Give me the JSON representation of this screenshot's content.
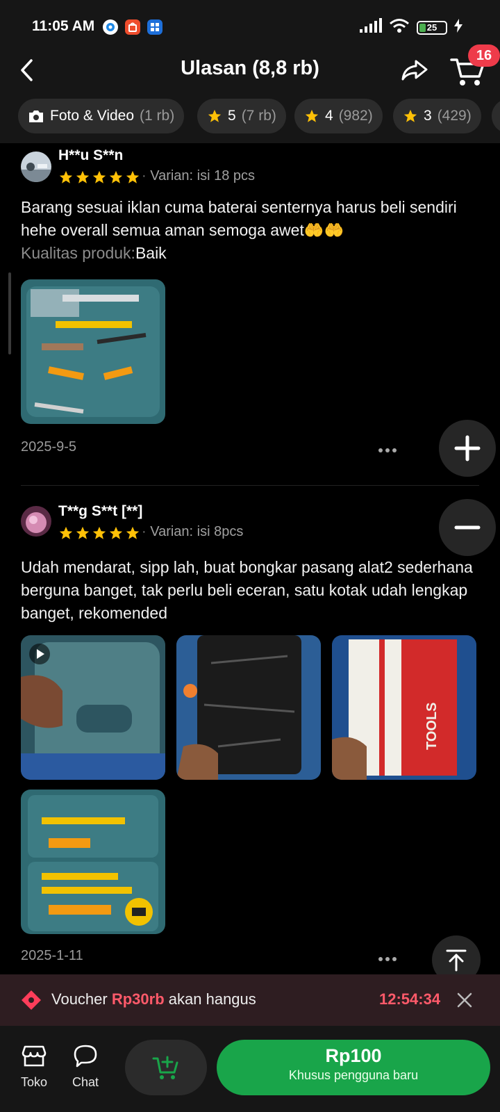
{
  "status_bar": {
    "time": "11:05 AM",
    "battery": "25",
    "battery_level": 0.25
  },
  "header": {
    "title": "Ulasan (8,8 rb)",
    "cart_badge": "16"
  },
  "filters": [
    {
      "label": "Foto & Video",
      "count": "(1 rb)"
    },
    {
      "label": "5",
      "count": "(7 rb)"
    },
    {
      "label": "4",
      "count": "(982)"
    },
    {
      "label": "3",
      "count": "(429)"
    }
  ],
  "reviews": [
    {
      "name": "H**u S**n",
      "rating": 5,
      "variant": "Varian: isi 18 pcs",
      "text": "Barang sesuai iklan cuma baterai senternya harus beli sendiri hehe overall semua aman semoga awet🤲🤲",
      "quality_label": "Kualitas produk:",
      "quality_value": "Baik",
      "date": "2025-9-5"
    },
    {
      "name": "T**g S**t [**]",
      "rating": 5,
      "variant": "Varian: isi 8pcs",
      "text": "Udah mendarat, sipp lah, buat bongkar pasang alat2 sederhana berguna banget, tak perlu beli eceran, satu kotak udah lengkap banget, rekomended",
      "photo_stamp": "TOOLS",
      "date": "2025-1-11"
    }
  ],
  "voucher": {
    "prefix": "Voucher",
    "amount": "Rp30rb",
    "suffix": "akan hangus",
    "timer": "12:54:34"
  },
  "bottom_bar": {
    "shop_label": "Toko",
    "chat_label": "Chat",
    "buy_price": "Rp100",
    "buy_sub": "Khusus pengguna baru"
  },
  "colors": {
    "accent_green": "#19a54a",
    "badge_red": "#ee3b4a",
    "star_yellow": "#ffc107",
    "voucher_red": "#ff5a6a"
  }
}
